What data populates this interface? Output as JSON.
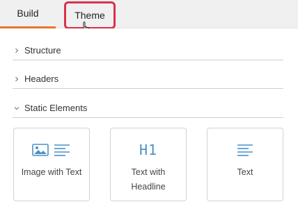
{
  "tabs": {
    "build": "Build",
    "theme": "Theme"
  },
  "sections": [
    {
      "label": "Structure",
      "expanded": false
    },
    {
      "label": "Headers",
      "expanded": false
    },
    {
      "label": "Static Elements",
      "expanded": true
    }
  ],
  "cards": [
    {
      "label": "Image with Text",
      "icon": "image-text-icon"
    },
    {
      "label": "Text with Headline",
      "icon": "h1-icon",
      "icon_text": "H1"
    },
    {
      "label": "Text",
      "icon": "text-lines-icon"
    }
  ],
  "colors": {
    "accent": "#e8762c",
    "highlight": "#d9314a",
    "icon": "#4a90c8"
  }
}
